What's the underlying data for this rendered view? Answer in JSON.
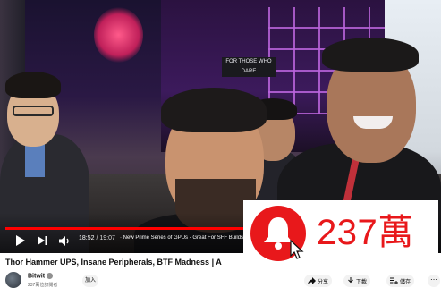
{
  "player": {
    "current_time": "18:52",
    "duration": "19:07",
    "chapter_title": "New Prime Series of GPUs - Great For SFF Builds",
    "progress": 0.985,
    "booth_sign": "FOR THOSE WHO DARE"
  },
  "overlay": {
    "count": "237萬",
    "icon": "bell-icon",
    "accent": "#e8181b"
  },
  "video": {
    "title": "Thor Hammer UPS, Insane Peripherals, BTF Madness | A"
  },
  "channel": {
    "name": "Bitwit",
    "subscribers": "237萬位訂閱者",
    "join_label": "加入"
  },
  "actions": {
    "share_label": "分享",
    "download_label": "下載",
    "save_label": "儲存"
  },
  "colors": {
    "progress": "#ff0000",
    "background": "#ffffff"
  }
}
